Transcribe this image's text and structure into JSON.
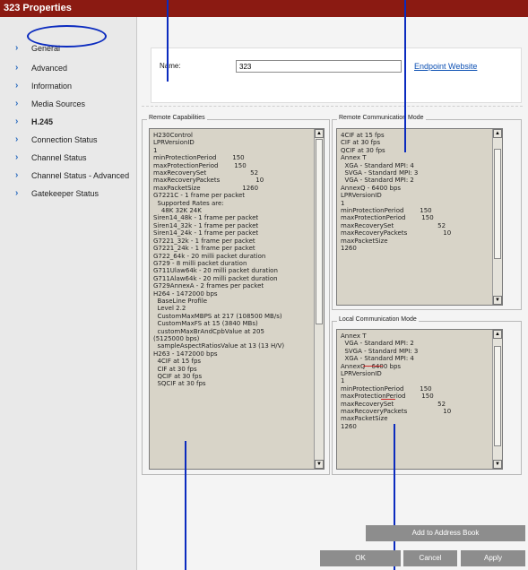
{
  "window": {
    "title": "323 Properties"
  },
  "sidebar": {
    "items": [
      {
        "label": "General",
        "active": false
      },
      {
        "label": "Advanced",
        "active": false
      },
      {
        "label": "Information",
        "active": false
      },
      {
        "label": "Media Sources",
        "active": false
      },
      {
        "label": "H.245",
        "active": true
      },
      {
        "label": "Connection Status",
        "active": false
      },
      {
        "label": "Channel Status",
        "active": false
      },
      {
        "label": "Channel Status - Advanced",
        "active": false
      },
      {
        "label": "Gatekeeper Status",
        "active": false
      }
    ]
  },
  "form": {
    "name_label": "Name:",
    "name_value": "323",
    "endpoint_link": "Endpoint Website"
  },
  "remote_capabilities": {
    "title": "Remote Capabilities",
    "lines": [
      "H230Control",
      "LPRVersionID",
      "1",
      "minProtectionPeriod        150",
      "maxProtectionPeriod        150",
      "maxRecoverySet                      52",
      "maxRecoveryPackets                  10",
      "maxPacketSize                     1260",
      "G7221C - 1 frame per packet",
      "  Supported Rates are:",
      "    48K 32K 24K",
      "Siren14_48k - 1 frame per packet",
      "Siren14_32k - 1 frame per packet",
      "Siren14_24k - 1 frame per packet",
      "G7221_32k - 1 frame per packet",
      "G7221_24k - 1 frame per packet",
      "G722_64k - 20 milli packet duration",
      "G729 - 8 milli packet duration",
      "G711Ulaw64k - 20 milli packet duration",
      "G711Alaw64k - 20 milli packet duration",
      "G729AnnexA - 2 frames per packet",
      "H264 - 1472000 bps",
      "  BaseLine Profile",
      "  Level 2.2",
      "  CustomMaxMBPS at 217 (108500 MB/s)",
      "  CustomMaxFS at 15 (3840 MBs)",
      "  customMaxBrAndCpbValue at 205",
      "(5125000 bps)",
      "  sampleAspectRatiosValue at 13 (13 H/V)",
      "H263 - 1472000 bps",
      "  4CIF at 15 fps",
      "  CIF at 30 fps",
      "  QCIF at 30 fps",
      "  SQCIF at 30 fps"
    ]
  },
  "remote_comm_mode": {
    "title": "Remote Communication Mode",
    "lines": [
      "4CIF at 15 fps",
      "CIF at 30 fps",
      "QCIF at 30 fps",
      "Annex T",
      "  XGA - Standard MPI: 4",
      "  SVGA - Standard MPI: 3",
      "  VGA - Standard MPI: 2",
      "AnnexQ - 6400 bps",
      "LPRVersionID",
      "1",
      "minProtectionPeriod        150",
      "maxProtectionPeriod        150",
      "maxRecoverySet                      52",
      "maxRecoveryPackets                  10",
      "maxPacketSize",
      "1260"
    ]
  },
  "local_comm_mode": {
    "title": "Local Communication Mode",
    "lines": [
      "Annex T",
      "  VGA - Standard MPI: 2",
      "  SVGA - Standard MPI: 3",
      "  XGA - Standard MPI: 4",
      "AnnexQ - 6400 bps",
      "LPRVersionID",
      "1",
      "minProtectionPeriod        150",
      "maxProtectionPeriod        150",
      "maxRecoverySet                      52",
      "maxRecoveryPackets                  10",
      "maxPacketSize",
      "1260"
    ]
  },
  "buttons": {
    "add_to_address_book": "Add to Address Book",
    "ok": "OK",
    "cancel": "Cancel",
    "apply": "Apply"
  },
  "colors": {
    "title_bar": "#8b1a12",
    "annotation": "#0b2bbf",
    "link": "#0b4fb3",
    "button": "#8d8d8d",
    "listbox_bg": "#d8d4c8"
  }
}
